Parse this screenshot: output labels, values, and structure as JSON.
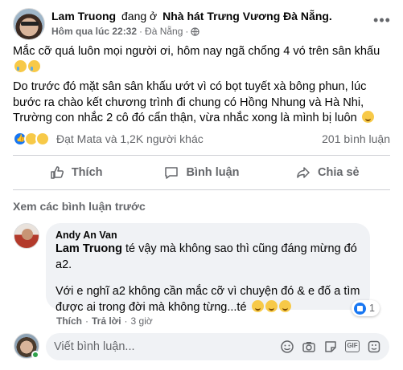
{
  "post": {
    "author": "Lam Truong",
    "at_text": "đang ở",
    "place": "Nhà hát Trưng Vương Đà Nẵng.",
    "time": "Hôm qua lúc 22:32",
    "location": "Đà Nẵng",
    "separator": "·",
    "paragraph1": "Mắc cỡ quá luôn mọi người ơi, hôm nay ngã chổng 4 vó trên sân khấu",
    "paragraph2": "Do trước đó mặt sân sân khấu ướt vì có bọt tuyết xà bông phun, lúc bước ra chào kết chương trình đi chung có Hồng Nhung và Hà Nhi, Trường con nhắc 2 cô đó cẩn thận, vừa nhắc xong là mình bị luôn",
    "icons": {
      "privacy": "globe-icon",
      "more": "more-options-icon"
    }
  },
  "reactions": {
    "text": "Đạt Mata và 1,2K người khác",
    "comments": "201 bình luận",
    "types": [
      "like",
      "haha",
      "love"
    ]
  },
  "actions": {
    "like": "Thích",
    "comment": "Bình luận",
    "share": "Chia sẻ"
  },
  "comments": {
    "view_previous": "Xem các bình luận trước",
    "items": [
      {
        "author": "Andy An Van",
        "mention": "Lam Truong",
        "line1": "té vậy mà không sao thì cũng đáng mừng đó a2.",
        "line2": "Với e nghĩ a2 không cần mắc cỡ vì chuyện đó & e đố a tìm được ai trong đời mà không từng...té",
        "reaction_count": "1",
        "like_label": "Thích",
        "reply_label": "Trả lời",
        "time": "3 giờ"
      }
    ]
  },
  "composer": {
    "placeholder": "Viết bình luận...",
    "tools": [
      "emoji-icon",
      "camera-icon",
      "sticker-icon",
      "gif-icon",
      "sticker-pack-icon"
    ],
    "gif_text": "GIF"
  },
  "colors": {
    "accent": "#1877f2",
    "muted": "#65676b",
    "bubble": "#f0f2f5"
  }
}
